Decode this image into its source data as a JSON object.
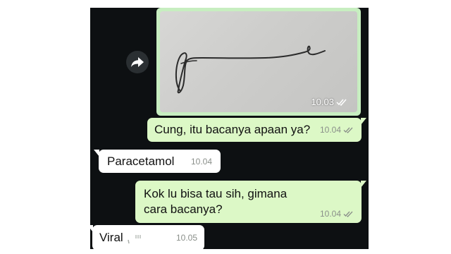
{
  "colors": {
    "chat_background": "#0d1012",
    "outgoing_bubble": "#dcf8c6",
    "incoming_bubble": "#ffffff",
    "read_tick": "#8a8f8a"
  },
  "icons": {
    "forward": "forward-arrow-icon",
    "read_receipt": "double-check-icon"
  },
  "messages": [
    {
      "direction": "outgoing",
      "type": "image",
      "time": "10.03"
    },
    {
      "direction": "outgoing",
      "type": "text",
      "text": "Cung, itu bacanya apaan ya?",
      "time": "10.04"
    },
    {
      "direction": "incoming",
      "type": "text",
      "text": "Paracetamol",
      "time": "10.04"
    },
    {
      "direction": "outgoing",
      "type": "text",
      "text": "Kok lu bisa tau sih, gimana cara bacanya?",
      "time": "10.04"
    },
    {
      "direction": "incoming",
      "type": "text",
      "text": "Viral",
      "time": "10.05"
    }
  ]
}
